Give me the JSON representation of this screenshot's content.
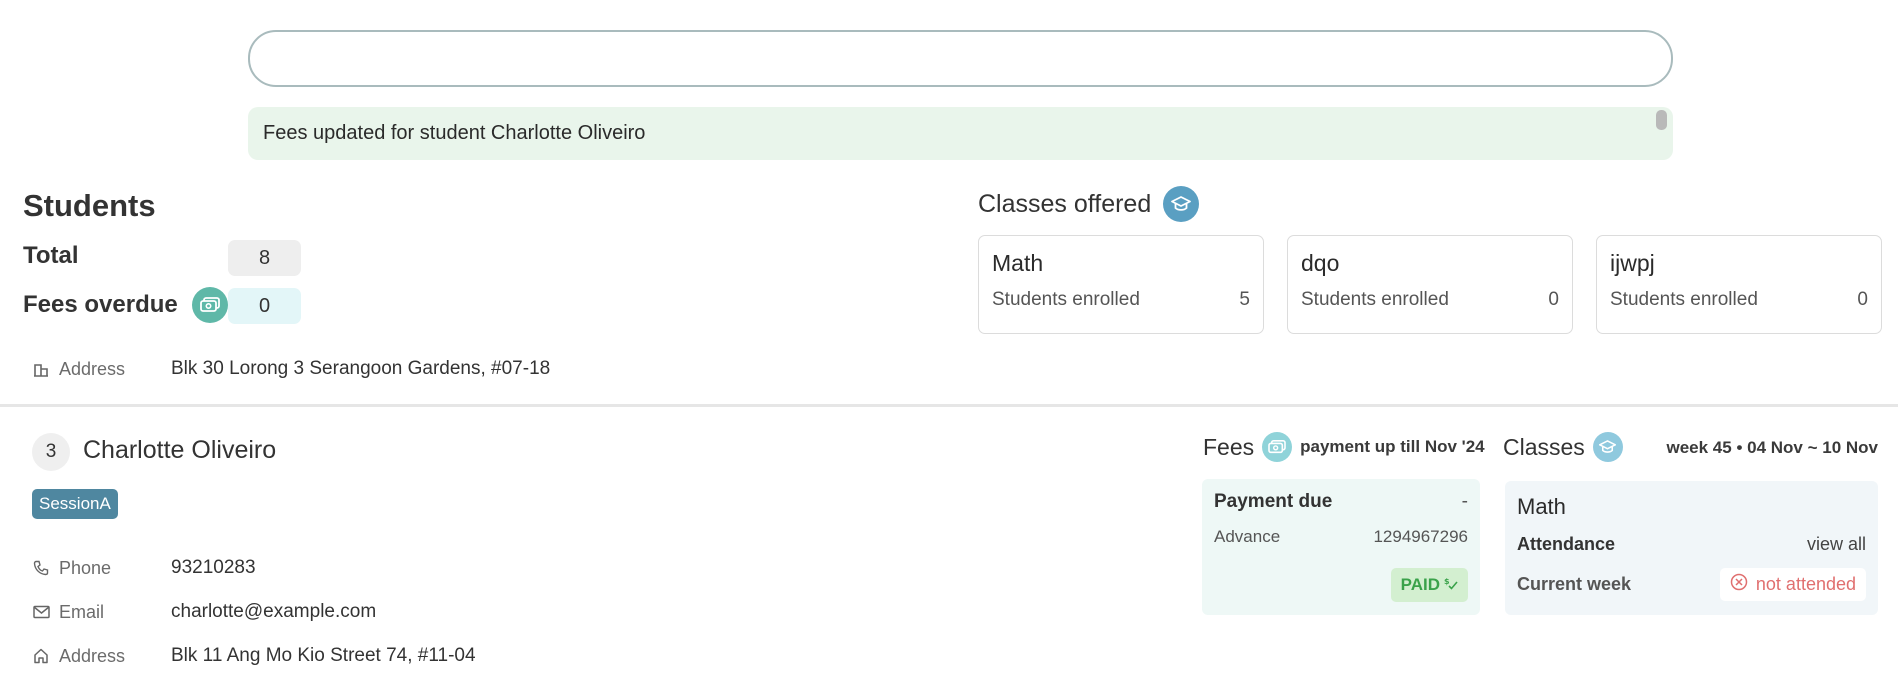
{
  "command": {
    "value": "",
    "placeholder": ""
  },
  "result": {
    "message": "Fees updated for student Charlotte Oliveiro"
  },
  "stats": {
    "title": "Students",
    "total_label": "Total",
    "total_value": "8",
    "overdue_label": "Fees overdue",
    "overdue_value": "0",
    "overdue_icon": "money-icon"
  },
  "classes_offered": {
    "title": "Classes offered",
    "icon": "graduation-cap-icon",
    "items": [
      {
        "name": "Math",
        "enrolled_label": "Students enrolled",
        "enrolled": "5"
      },
      {
        "name": "dqo",
        "enrolled_label": "Students enrolled",
        "enrolled": "0"
      },
      {
        "name": "ijwpj",
        "enrolled_label": "Students enrolled",
        "enrolled": "0"
      }
    ]
  },
  "previous_student": {
    "address_label": "Address",
    "address": "Blk 30 Lorong 3 Serangoon Gardens, #07-18"
  },
  "student": {
    "index": "3",
    "name": "Charlotte Oliveiro",
    "tag": "SessionA",
    "phone_label": "Phone",
    "phone": "93210283",
    "email_label": "Email",
    "email": "charlotte@example.com",
    "address_label": "Address",
    "address": "Blk 11 Ang Mo Kio Street 74, #11-04"
  },
  "fees": {
    "title": "Fees",
    "subtitle": "payment up till Nov '24",
    "payment_due_label": "Payment due",
    "payment_due": "-",
    "advance_label": "Advance",
    "advance": "1294967296",
    "status": "PAID"
  },
  "classes": {
    "title": "Classes",
    "week": "week 45 • 04 Nov ~ 10 Nov",
    "class_name": "Math",
    "attendance_label": "Attendance",
    "view_all": "view all",
    "current_week_label": "Current week",
    "current_week_status": "not attended"
  },
  "colors": {
    "accent_teal": "#5fb8c4",
    "tag_blue": "#4f87a0",
    "paid_green": "#3aa24a",
    "not_attended_red": "#e06f6f"
  }
}
